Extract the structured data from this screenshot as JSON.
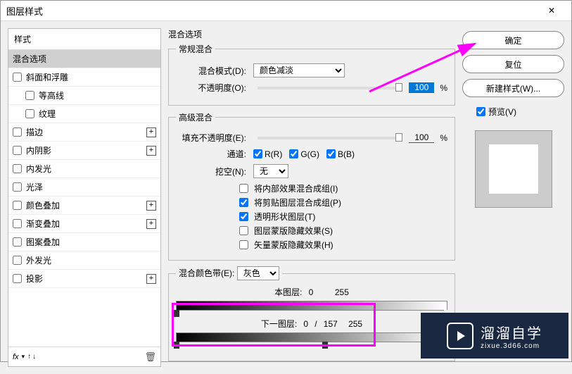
{
  "title": "图层样式",
  "styles_header": "样式",
  "style_items": [
    {
      "label": "混合选项",
      "selected": true,
      "checkbox": false
    },
    {
      "label": "斜面和浮雕",
      "checkbox": true,
      "plus": false
    },
    {
      "label": "等高线",
      "checkbox": true,
      "indent": true
    },
    {
      "label": "纹理",
      "checkbox": true,
      "indent": true
    },
    {
      "label": "描边",
      "checkbox": true,
      "plus": true
    },
    {
      "label": "内阴影",
      "checkbox": true,
      "plus": true
    },
    {
      "label": "内发光",
      "checkbox": true
    },
    {
      "label": "光泽",
      "checkbox": true
    },
    {
      "label": "颜色叠加",
      "checkbox": true,
      "plus": true
    },
    {
      "label": "渐变叠加",
      "checkbox": true,
      "plus": true
    },
    {
      "label": "图案叠加",
      "checkbox": true
    },
    {
      "label": "外发光",
      "checkbox": true
    },
    {
      "label": "投影",
      "checkbox": true,
      "plus": true
    }
  ],
  "fx": "fx",
  "blend_options_title": "混合选项",
  "normal_blend": {
    "legend": "常规混合",
    "mode_label": "混合模式(D):",
    "mode_value": "颜色减淡",
    "opacity_label": "不透明度(O):",
    "opacity_value": "100",
    "pct": "%"
  },
  "advanced_blend": {
    "legend": "高级混合",
    "fill_label": "填充不透明度(E):",
    "fill_value": "100",
    "channels_label": "通道:",
    "r": "R(R)",
    "g": "G(G)",
    "b": "B(B)",
    "knockout_label": "挖空(N):",
    "knockout_value": "无",
    "opt1": "将内部效果混合成组(I)",
    "opt2": "将剪贴图层混合成组(P)",
    "opt3": "透明形状图层(T)",
    "opt4": "图层蒙版隐藏效果(S)",
    "opt5": "矢量蒙版隐藏效果(H)"
  },
  "blend_if": {
    "legend_label": "混合颜色带(E):",
    "color": "灰色",
    "this_layer": "本图层:",
    "this_v1": "0",
    "this_v2": "255",
    "under_layer": "下一图层:",
    "under_v1": "0",
    "under_v2": "157",
    "under_v3": "255",
    "sep": "/"
  },
  "buttons": {
    "ok": "确定",
    "cancel": "复位",
    "new_style": "新建样式(W)...",
    "preview": "预览(V)"
  },
  "watermark": {
    "main": "溜溜自学",
    "sub": "zixue.3d66.com"
  }
}
